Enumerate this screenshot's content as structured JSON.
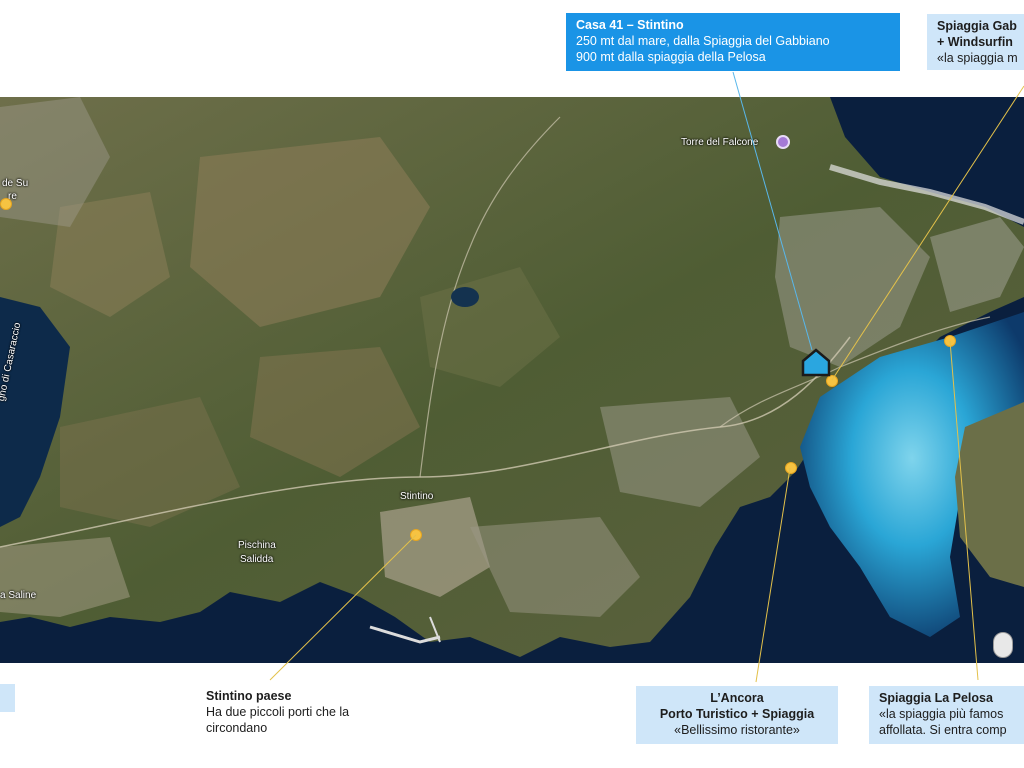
{
  "callouts": {
    "casa": {
      "title": "Casa 41 – Stintino",
      "line1": "250 mt dal mare, dalla Spiaggia del Gabbiano",
      "line2": "900 mt dalla spiaggia della Pelosa"
    },
    "gabbiano": {
      "title1": "Spiaggia Gab",
      "title2": "+ Windsurfin",
      "line1": "«la spiaggia m"
    },
    "paese": {
      "title": "Stintino paese",
      "line1": "Ha due piccoli porti che la",
      "line2": "circondano"
    },
    "ancora": {
      "title1": "L’Ancora",
      "title2": "Porto Turistico + Spiaggia",
      "line1": "«Bellissimo ristorante»"
    },
    "pelosa": {
      "title": "Spiaggia La Pelosa",
      "line1": "«la spiaggia più famos",
      "line2": "affollata. Si entra comp"
    }
  },
  "map_labels": {
    "torre": "Torre del Falcone",
    "stintino": "Stintino",
    "pischina1": "Pischina",
    "pischina2": "Salidda",
    "saline": "a Saline",
    "desu1": "de Su",
    "desu2": "re",
    "stagno": "gno di Casaraccio"
  },
  "icons": {
    "poi": "yellow-dot-marker",
    "torre": "purple-landmark-icon",
    "house": "house-icon",
    "pegman": "street-view-pegman-icon"
  },
  "colors": {
    "callout_primary": "#1a94e6",
    "callout_light": "#cfe6f9",
    "marker": "#f6c342",
    "sea_deep": "#0a1f3e",
    "sea_shallow": "#2aa6d6",
    "land": "#5d6a3c"
  }
}
